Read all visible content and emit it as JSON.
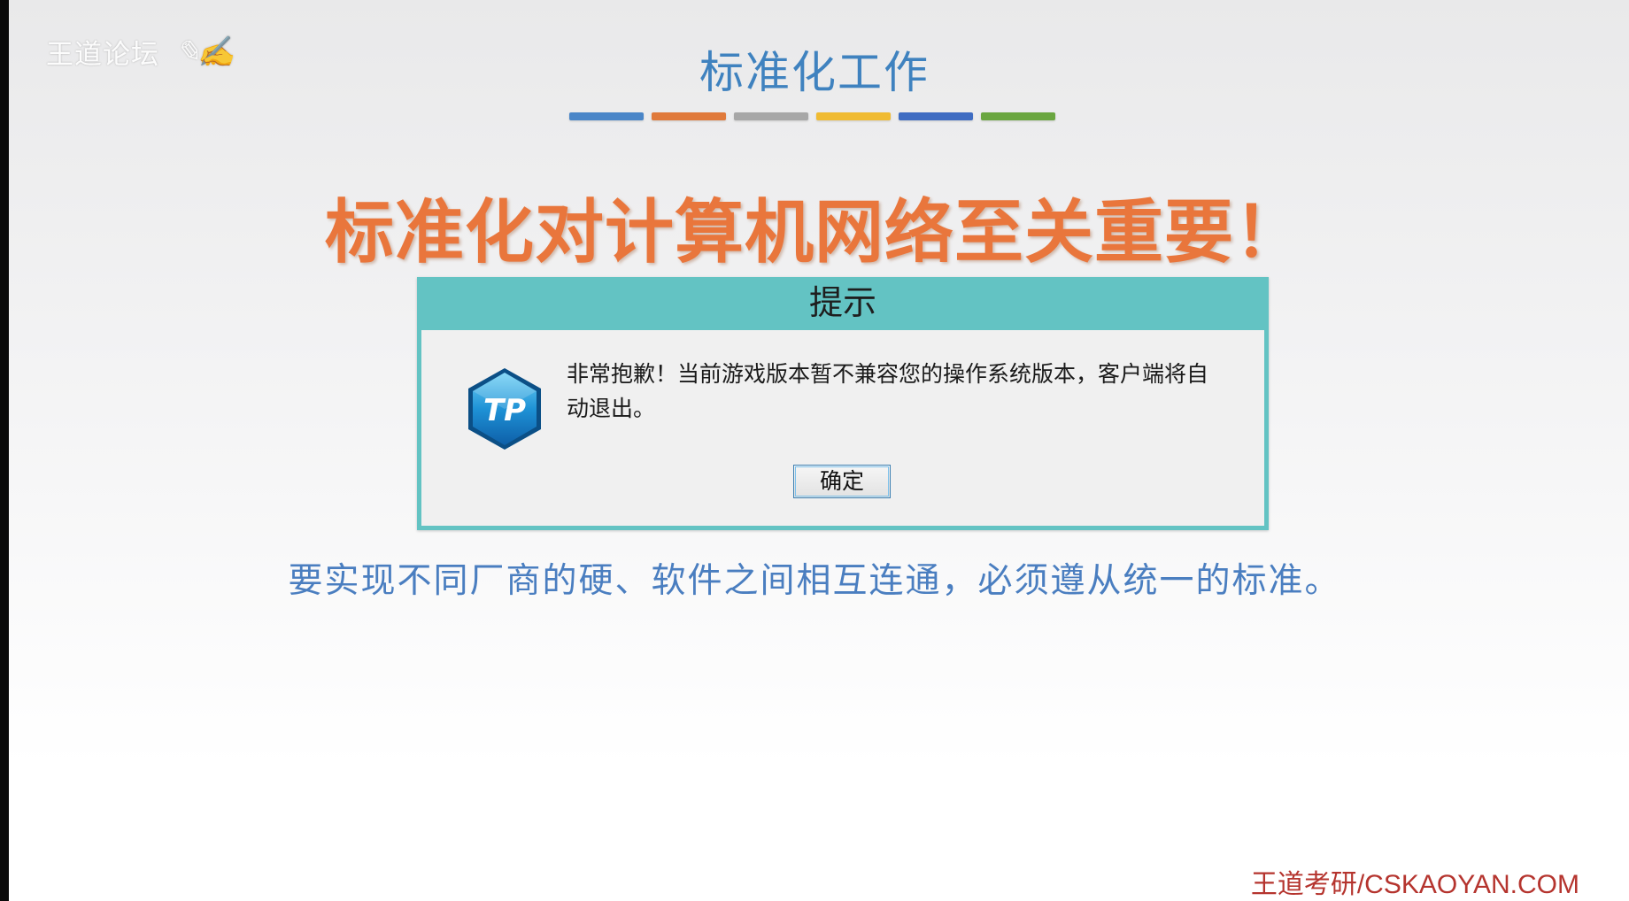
{
  "watermark": {
    "text": "王道论坛",
    "logo_text": "王道考研"
  },
  "slide": {
    "title": "标准化工作",
    "accent_bar_colors": [
      "#4a86c8",
      "#e07a3b",
      "#a7a7a7",
      "#f0bb32",
      "#3f6cc2",
      "#6aa640"
    ],
    "headline": "标准化对计算机网络至关重要！",
    "subtext": "要实现不同厂商的硬、软件之间相互连通，必须遵从统一的标准。"
  },
  "dialog": {
    "title": "提示",
    "icon": "tp-logo-icon",
    "icon_text": "TP",
    "message": "非常抱歉！当前游戏版本暂不兼容您的操作系统版本，客户端将自动退出。",
    "ok_label": "确定"
  },
  "footer": {
    "site": "王道考研/CSKAOYAN.COM"
  }
}
